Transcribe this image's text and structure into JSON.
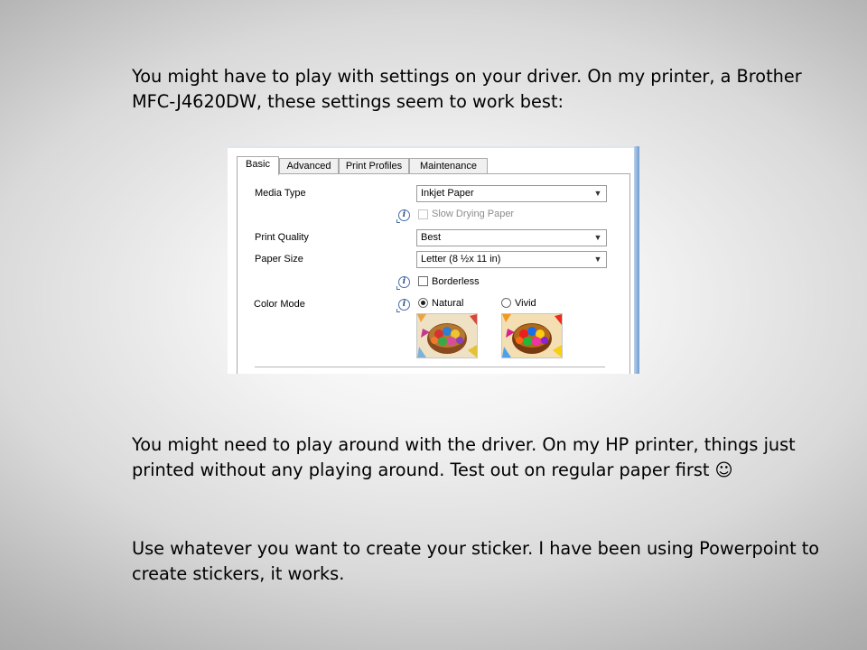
{
  "slide": {
    "paragraph_1": "You might have to play with settings on your driver.  On my printer, a Brother MFC-J4620DW, these settings seem to work best:",
    "paragraph_2": "You might need to play around with the driver.  On my HP printer, things just printed without any playing around.  Test out on regular paper first ☺",
    "paragraph_3": "Use whatever you want to create your sticker.  I have been using Powerpoint to create stickers, it works."
  },
  "dialog": {
    "tabs": [
      {
        "label": "Basic",
        "active": true
      },
      {
        "label": "Advanced",
        "active": false
      },
      {
        "label": "Print Profiles",
        "active": false
      },
      {
        "label": "Maintenance",
        "active": false
      }
    ],
    "media_type": {
      "label": "Media Type",
      "value": "Inkjet Paper"
    },
    "slow_drying": {
      "label": "Slow Drying Paper",
      "checked": false,
      "enabled": false
    },
    "print_quality": {
      "label": "Print Quality",
      "value": "Best"
    },
    "paper_size": {
      "label": "Paper Size",
      "value": "Letter (8 ½x 11 in)"
    },
    "borderless": {
      "label": "Borderless",
      "checked": false
    },
    "color_mode": {
      "label": "Color Mode",
      "options": [
        {
          "label": "Natural",
          "selected": true
        },
        {
          "label": "Vivid",
          "selected": false
        }
      ]
    },
    "icons": {
      "info": "info-icon",
      "dropdown": "chevron-down-icon"
    }
  }
}
